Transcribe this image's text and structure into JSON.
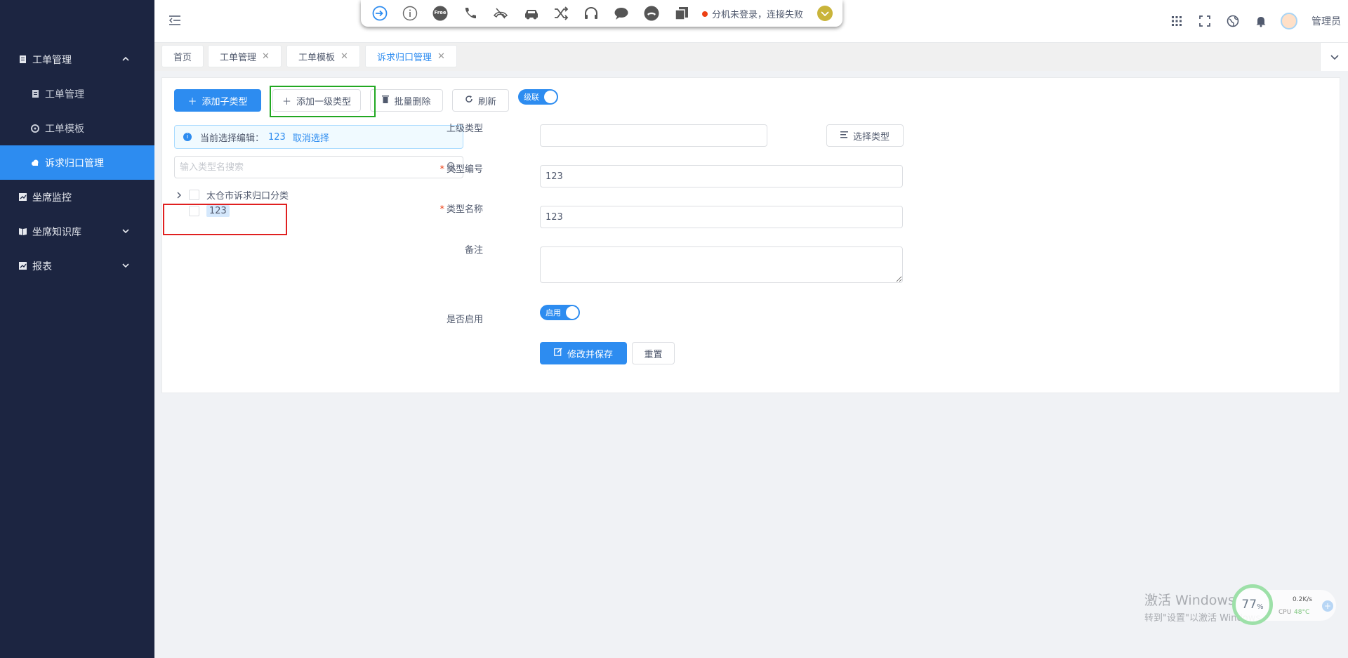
{
  "sidebar": {
    "items": [
      {
        "label": "工单管理",
        "level": "top",
        "expanded": true
      },
      {
        "label": "工单管理",
        "level": "sub"
      },
      {
        "label": "工单模板",
        "level": "sub"
      },
      {
        "label": "诉求归口管理",
        "level": "sub",
        "active": true
      },
      {
        "label": "坐席监控",
        "level": "top"
      },
      {
        "label": "坐席知识库",
        "level": "top",
        "expanded": false
      },
      {
        "label": "报表",
        "level": "top",
        "expanded": false
      }
    ]
  },
  "toolbar": {
    "icons": [
      "sign-in-icon",
      "info-icon",
      "free-icon",
      "phone-icon",
      "hangup-icon",
      "car-icon",
      "shuffle-icon",
      "headset-icon",
      "chat-icon",
      "end-call-icon",
      "copy-icon"
    ],
    "free_text": "Free",
    "status_text": "分机未登录，连接失败"
  },
  "header": {
    "admin_name": "管理员",
    "right_icons": [
      "apps-icon",
      "fullscreen-icon",
      "globe-icon",
      "bell-icon"
    ]
  },
  "tabs": [
    {
      "label": "首页",
      "closable": false,
      "active": false
    },
    {
      "label": "工单管理",
      "closable": true,
      "active": false
    },
    {
      "label": "工单模板",
      "closable": true,
      "active": false
    },
    {
      "label": "诉求归口管理",
      "closable": true,
      "active": true
    }
  ],
  "actions": {
    "add_child": "添加子类型",
    "add_top": "添加一级类型",
    "batch_delete": "批量删除",
    "refresh": "刷新",
    "cascade_label": "级联",
    "cascade_on": true
  },
  "alert": {
    "prefix": "当前选择编辑：",
    "value": "123",
    "cancel": "取消选择"
  },
  "search": {
    "placeholder": "输入类型名搜索"
  },
  "tree": [
    {
      "label": "太仓市诉求归口分类",
      "has_children": true,
      "checked": false
    },
    {
      "label": "123",
      "has_children": false,
      "checked": false,
      "selected": true
    }
  ],
  "form": {
    "parent_label": "上级类型",
    "parent_value": "",
    "select_type_button": "选择类型",
    "code_label": "类型编号",
    "code_value": "123",
    "name_label": "类型名称",
    "name_value": "123",
    "remark_label": "备注",
    "remark_value": "",
    "enabled_label": "是否启用",
    "enabled_switch_text": "启用",
    "enabled": true,
    "save_button": "修改并保存",
    "reset_button": "重置"
  },
  "watermark": {
    "line1": "激活 Windows",
    "line2": "转到\"设置\"以激活 Windows。",
    "gauge": "77",
    "gauge_unit": "%",
    "net_speed": "0.2K/s",
    "cpu_label": "CPU",
    "cpu_temp": "48°C"
  },
  "colors": {
    "sidebar_bg": "#1c2541",
    "primary": "#2d8cf0",
    "annotation_green": "#22a822",
    "annotation_red": "#e02020"
  }
}
